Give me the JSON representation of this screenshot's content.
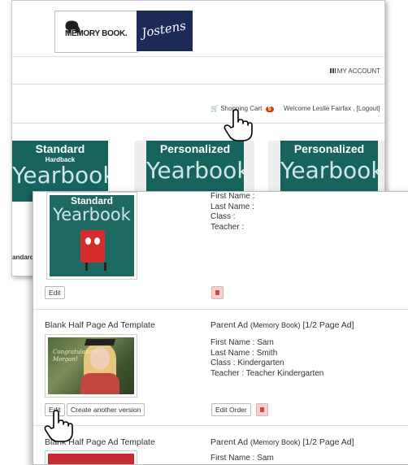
{
  "header": {
    "memorybook_logo": "MEMORY BOOK.",
    "jostens_logo": "Jostens",
    "my_account": "MY ACCOUNT",
    "shopping_cart": "Shopping Cart",
    "cart_count": "5",
    "welcome": "Welcome Leslie Fairfax , [Logout]"
  },
  "products": [
    {
      "title": "Standard",
      "subtitle": "Hardback",
      "word": "Yearbook"
    },
    {
      "title": "Personalized",
      "word": "Yearbook"
    },
    {
      "title": "Personalized",
      "word": "Yearbook"
    }
  ],
  "back_label": "andard",
  "cart_items": [
    {
      "thumb_title": "Standard",
      "thumb_word": "Yearbook",
      "fields": [
        "First Name :",
        "Last Name :",
        "Class :",
        "Teacher :"
      ],
      "edit": "Edit"
    },
    {
      "title": "Blank Half Page Ad Template",
      "right_title_main": "Parent Ad ",
      "right_title_small": "(Memory Book)",
      "right_title_tail": " [1/2 Page Ad]",
      "photo_text": "Congratulations Morgan!",
      "fields": [
        "First Name : Sam",
        "Last Name : Smith",
        "Class : Kindergarten",
        "Teacher : Teacher Kindergarten"
      ],
      "edit": "Edit",
      "create_version": "Create another version",
      "edit_order": "Edit Order"
    },
    {
      "title": "Blank Half Page Ad Template",
      "right_title_main": "Parent Ad ",
      "right_title_small": "(Memory Book)",
      "right_title_tail": " [1/2 Page Ad]",
      "partial_field": "First Name : Sam"
    }
  ],
  "colors": {
    "teal": "#17645f",
    "jostens_navy": "#1b2a57",
    "badge": "#d43f00",
    "trash": "#f4d2d2"
  }
}
